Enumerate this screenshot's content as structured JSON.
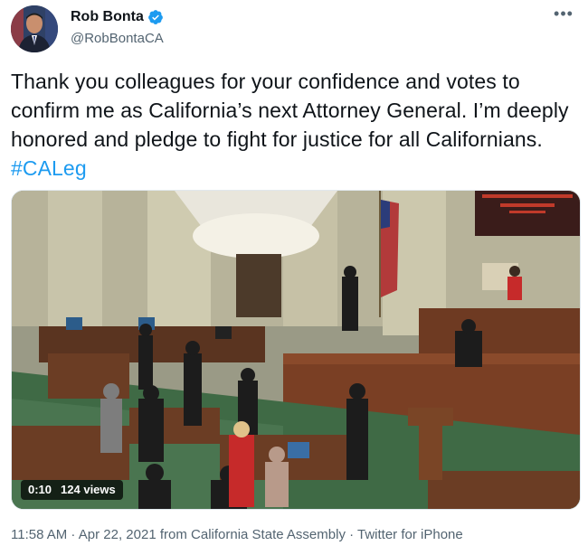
{
  "user": {
    "display_name": "Rob Bonta",
    "handle": "@RobBontaCA",
    "verified": true
  },
  "tweet": {
    "text": "Thank you colleagues for your confidence and votes to confirm me as California’s next Attorney General. I’m deeply honored and pledge to fight for justice for all Californians. ",
    "hashtag": "#CALeg"
  },
  "video": {
    "elapsed": "0:10",
    "views": "124 views"
  },
  "footer": {
    "time": "11:58 AM",
    "separator": " · ",
    "date": "Apr 22, 2021",
    "source": "from California State Assembly",
    "client": "Twitter for iPhone"
  },
  "colors": {
    "link": "#1d9bf0",
    "secondary_text": "#536471",
    "verified_badge": "#1d9bf0"
  },
  "icons": {
    "verified": "verified-badge-icon",
    "more": "more-options-icon"
  }
}
